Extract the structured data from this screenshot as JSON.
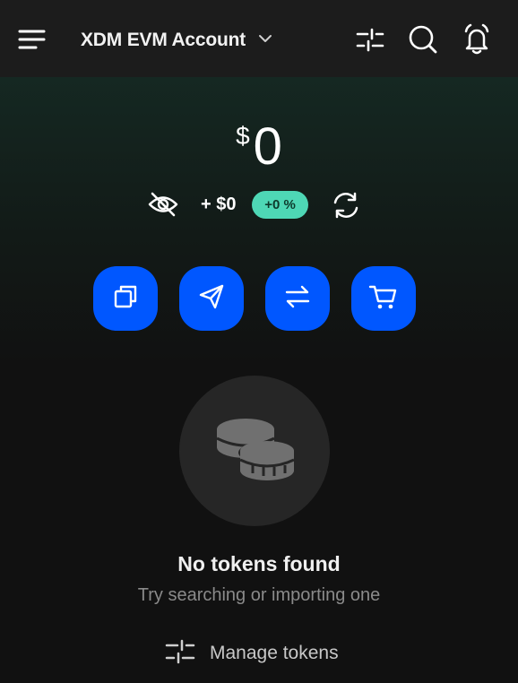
{
  "header": {
    "account_name": "XDM EVM Account",
    "icons": {
      "menu": "hamburger-menu-icon",
      "chevron": "chevron-down-icon",
      "filter": "sliders-icon",
      "search": "search-icon",
      "notifications": "bell-icon"
    }
  },
  "balance": {
    "currency_symbol": "$",
    "amount": "0",
    "change_amount": "+ $0",
    "change_percent": "+0 %"
  },
  "actions": [
    {
      "icon": "copy-icon"
    },
    {
      "icon": "send-icon"
    },
    {
      "icon": "swap-icon"
    },
    {
      "icon": "cart-icon"
    }
  ],
  "empty_state": {
    "icon": "coins-icon",
    "title": "No tokens found",
    "subtitle": "Try searching or importing one"
  },
  "manage_tokens": {
    "label": "Manage tokens",
    "icon": "sliders-icon"
  },
  "colors": {
    "accent_blue": "#0057FF",
    "badge_green": "#4ED7B5",
    "background": "#111111",
    "header_bg": "#1C1C1C"
  }
}
